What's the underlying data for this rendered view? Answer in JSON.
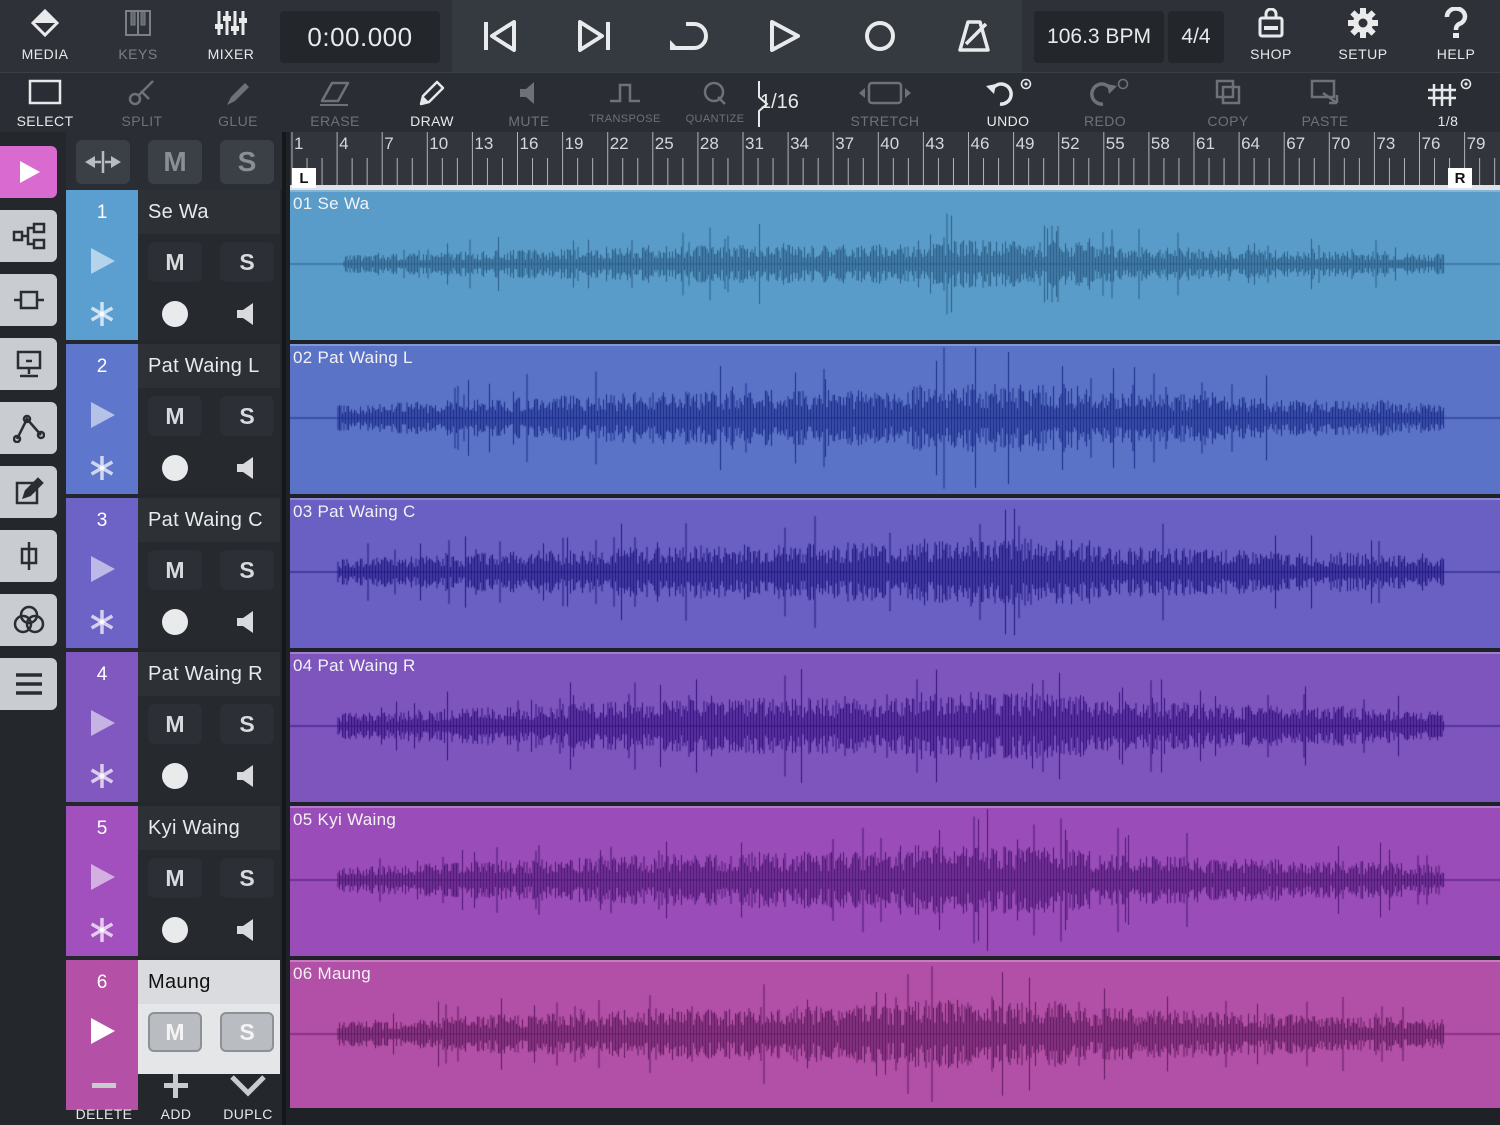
{
  "topbar": {
    "media": "MEDIA",
    "keys": "KEYS",
    "mixer": "MIXER",
    "time": "0:00.000",
    "bpm": "106.3 BPM",
    "signature": "4/4",
    "shop": "SHOP",
    "setup": "SETUP",
    "help": "HELP"
  },
  "tools": {
    "select": "SELECT",
    "split": "SPLIT",
    "glue": "GLUE",
    "erase": "ERASE",
    "draw": "DRAW",
    "mute": "MUTE",
    "transpose": "TRANSPOSE",
    "quantize": "QUANTIZE",
    "quantize_value": "1/16",
    "stretch": "STRETCH",
    "undo": "UNDO",
    "redo": "REDO",
    "copy": "COPY",
    "paste": "PASTE",
    "grid_value": "1/8"
  },
  "header": {
    "m": "M",
    "s": "S"
  },
  "ruler": {
    "bars": [
      "1",
      "4",
      "7",
      "10",
      "13",
      "16",
      "19",
      "22",
      "25",
      "28",
      "31",
      "34",
      "37",
      "40",
      "43",
      "46",
      "49",
      "52",
      "55",
      "58",
      "61",
      "64",
      "67",
      "70",
      "73",
      "76",
      "79"
    ],
    "left_marker": "L",
    "right_marker": "R"
  },
  "tracks": [
    {
      "num": "1",
      "name": "Se Wa",
      "region": "01 Se Wa",
      "color": "#5a9cc9",
      "wave": "#2b5d86",
      "numcolor": "#5b9ed0"
    },
    {
      "num": "2",
      "name": "Pat Waing L",
      "region": "02 Pat Waing L",
      "color": "#5b73c6",
      "wave": "#1b2c8a",
      "numcolor": "#5e76cb"
    },
    {
      "num": "3",
      "name": "Pat Waing C",
      "region": "03 Pat Waing C",
      "color": "#6a5fc2",
      "wave": "#1e1980",
      "numcolor": "#6d62c6"
    },
    {
      "num": "4",
      "name": "Pat Waing R",
      "region": "04 Pat Waing R",
      "color": "#7d55bd",
      "wave": "#35117e",
      "numcolor": "#8158c0"
    },
    {
      "num": "5",
      "name": "Kyi Waing",
      "region": "05 Kyi Waing",
      "color": "#9a4cb8",
      "wave": "#4b1673",
      "numcolor": "#a150be"
    },
    {
      "num": "6",
      "name": "Maung",
      "region": "06 Maung",
      "color": "#b24fa6",
      "wave": "#5e1b5e",
      "numcolor": "#b450a6"
    }
  ],
  "bottom": {
    "delete": "DELETE",
    "add": "ADD",
    "duplicate": "DUPLC"
  },
  "icons": {
    "sidebar": [
      "play-icon",
      "routing-icon",
      "channel-icon",
      "monitor-icon",
      "automation-icon",
      "edit-icon",
      "insert-icon",
      "fx-icon",
      "list-icon"
    ]
  }
}
